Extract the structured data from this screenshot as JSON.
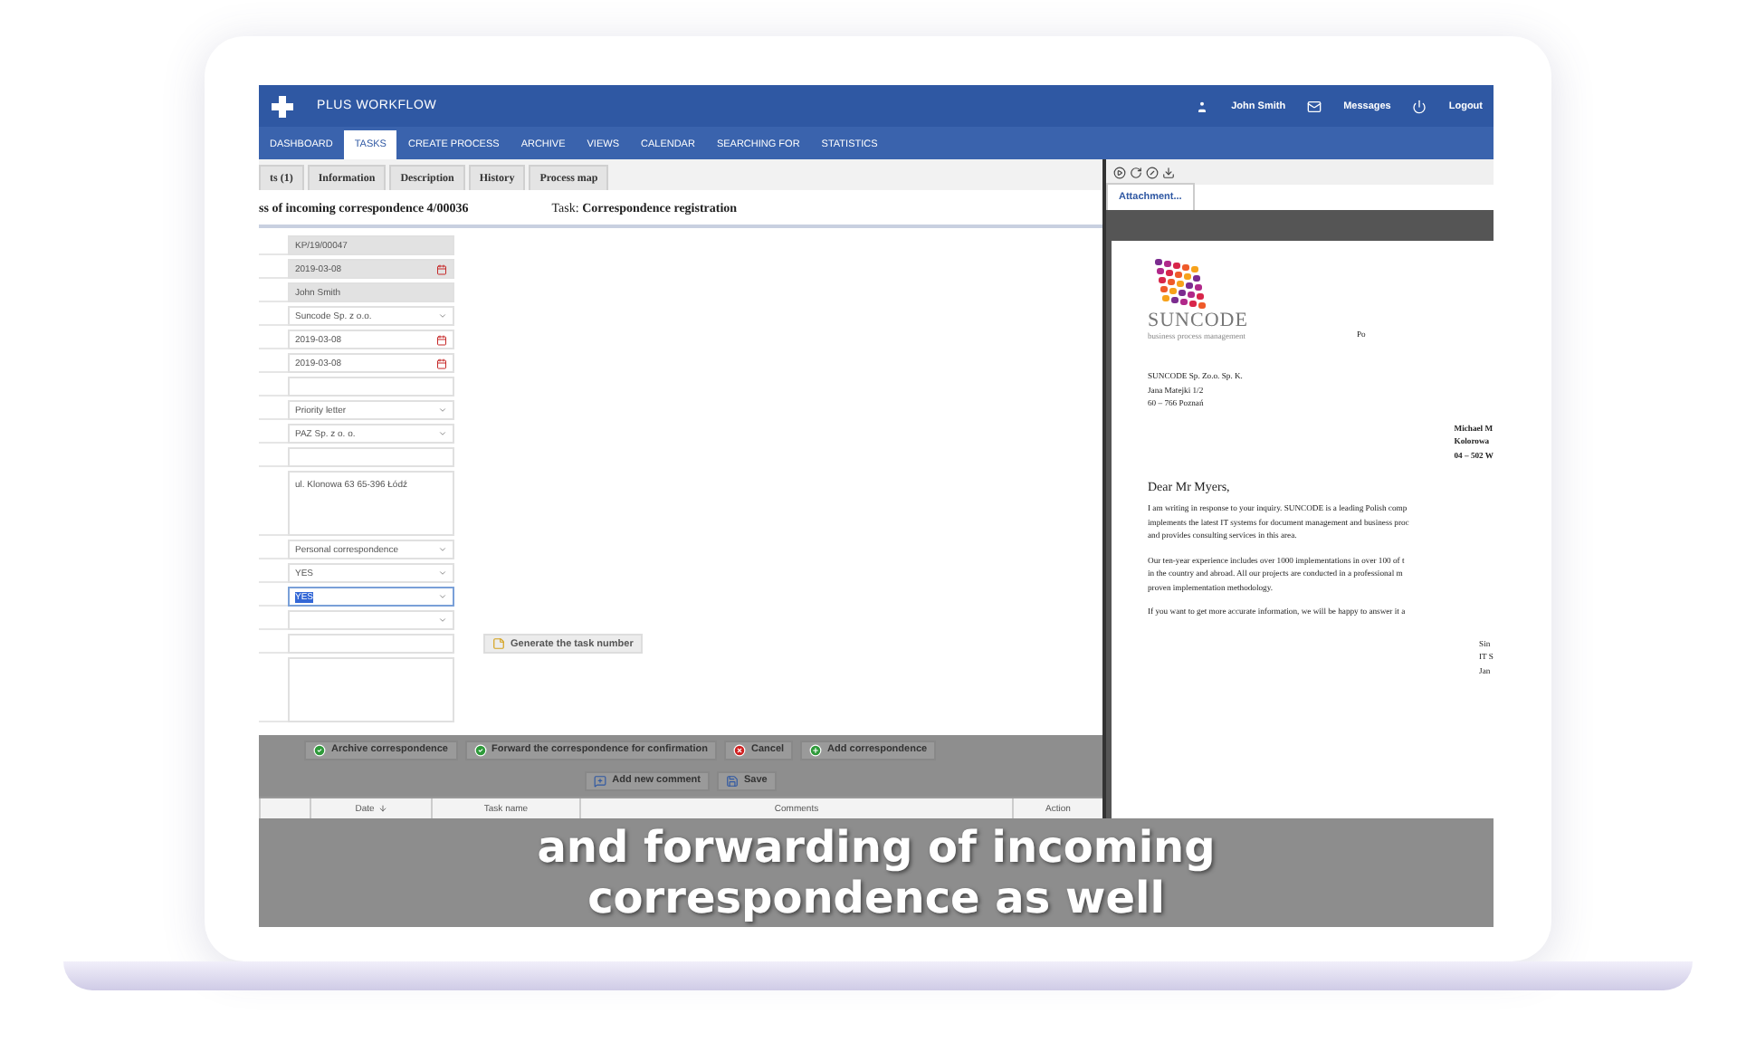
{
  "app": {
    "logo": "PLUS WORKFLOW",
    "user": "John Smith",
    "messages": "Messages",
    "logout": "Logout"
  },
  "nav": [
    {
      "label": "DASHBOARD",
      "selected": false
    },
    {
      "label": "TASKS",
      "selected": true
    },
    {
      "label": "CREATE PROCESS",
      "selected": false
    },
    {
      "label": "ARCHIVE",
      "selected": false
    },
    {
      "label": "VIEWS",
      "selected": false
    },
    {
      "label": "CALENDAR",
      "selected": false
    },
    {
      "label": "SEARCHING FOR",
      "selected": false
    },
    {
      "label": "STATISTICS",
      "selected": false
    }
  ],
  "tabs": [
    {
      "label": "ts (1)",
      "selected": false
    },
    {
      "label": "Information",
      "selected": false
    },
    {
      "label": "Description",
      "selected": false
    },
    {
      "label": "History",
      "selected": false
    },
    {
      "label": "Process map",
      "selected": false
    }
  ],
  "process_title": "ss of incoming correspondence 4/00036",
  "task": "Task: **Correspondence registration**",
  "form": {
    "fields": [
      {
        "kind": "text",
        "value": "KP/19/00047",
        "readonly": true
      },
      {
        "kind": "date",
        "value": "2019-03-08",
        "readonly": true
      },
      {
        "kind": "text",
        "value": "John Smith",
        "readonly": true
      },
      {
        "kind": "select",
        "value": "Suncode Sp. z o.o.",
        "readonly": false
      },
      {
        "kind": "date",
        "value": "2019-03-08",
        "readonly": false
      },
      {
        "kind": "date",
        "value": "2019-03-08",
        "readonly": false
      },
      {
        "kind": "text",
        "readonly": false
      },
      {
        "kind": "select",
        "value": "Priority letter",
        "readonly": false
      },
      {
        "kind": "select",
        "value": "PAZ Sp. z o. o.",
        "readonly": false
      },
      {
        "kind": "text",
        "readonly": false
      },
      {
        "kind": "textarea",
        "value": "ul. Klonowa 63 65-396 Łódź",
        "readonly": false
      },
      {
        "kind": "select",
        "value": "Personal correspondence",
        "readonly": false
      },
      {
        "kind": "select",
        "value": "YES",
        "readonly": false
      },
      {
        "kind": "select",
        "value": "YES",
        "readonly": false,
        "highlighted": true
      },
      {
        "kind": "select",
        "readonly": false
      },
      {
        "kind": "text",
        "readonly": false,
        "button": "Generate the task number"
      },
      {
        "kind": "textarea",
        "readonly": false
      }
    ]
  },
  "actions": [
    {
      "label": "Archive correspondence",
      "kind": "confirm"
    },
    {
      "label": "Forward the correspondence for confirmation",
      "kind": "confirm"
    },
    {
      "label": "Cancel",
      "kind": "cancel"
    },
    {
      "label": "Add correspondence",
      "kind": "add"
    }
  ],
  "comment_buttons": [
    {
      "label": "Add new comment",
      "kind": "comment"
    },
    {
      "label": "Save",
      "kind": "save"
    }
  ],
  "comments_table": {
    "columns": [
      {
        "label": "Date",
        "sorted": true
      },
      {
        "label": "Task name",
        "sorted": false
      },
      {
        "label": "Comments",
        "sorted": false
      },
      {
        "label": "Action",
        "sorted": false
      }
    ]
  },
  "viewer": {
    "tabs": [
      {
        "label": "Attachment...",
        "selected": true
      }
    ],
    "document": {
      "logo": "SUNCODE",
      "tagline": "business process management",
      "header_right": "Po",
      "sender": [
        "SUNCODE Sp. Zo.o. Sp. K.",
        "Jana Matejki 1/2",
        "60 – 766 Poznań"
      ],
      "recipient": [
        "Michael M",
        "Kolorowa",
        "04 – 502 W"
      ],
      "greeting": "Dear Mr Myers,",
      "paragraphs": [
        [
          "I am writing in response to your inquiry. SUNCODE is a leading Polish comp",
          "implements the latest IT systems for document management and business proc",
          "and provides consulting services in this area."
        ],
        [
          "Our ten-year experience includes over 1000 implementations in over 100 of t",
          "in the country and abroad. All our projects are conducted in a professional m",
          "proven implementation methodology."
        ],
        [
          "If you want to get more accurate information, we will be happy to answer it a"
        ]
      ],
      "closing": [
        "Sin",
        "IT S",
        "Jan"
      ]
    }
  },
  "caption": [
    "and forwarding of incoming",
    "correspondence as well"
  ]
}
